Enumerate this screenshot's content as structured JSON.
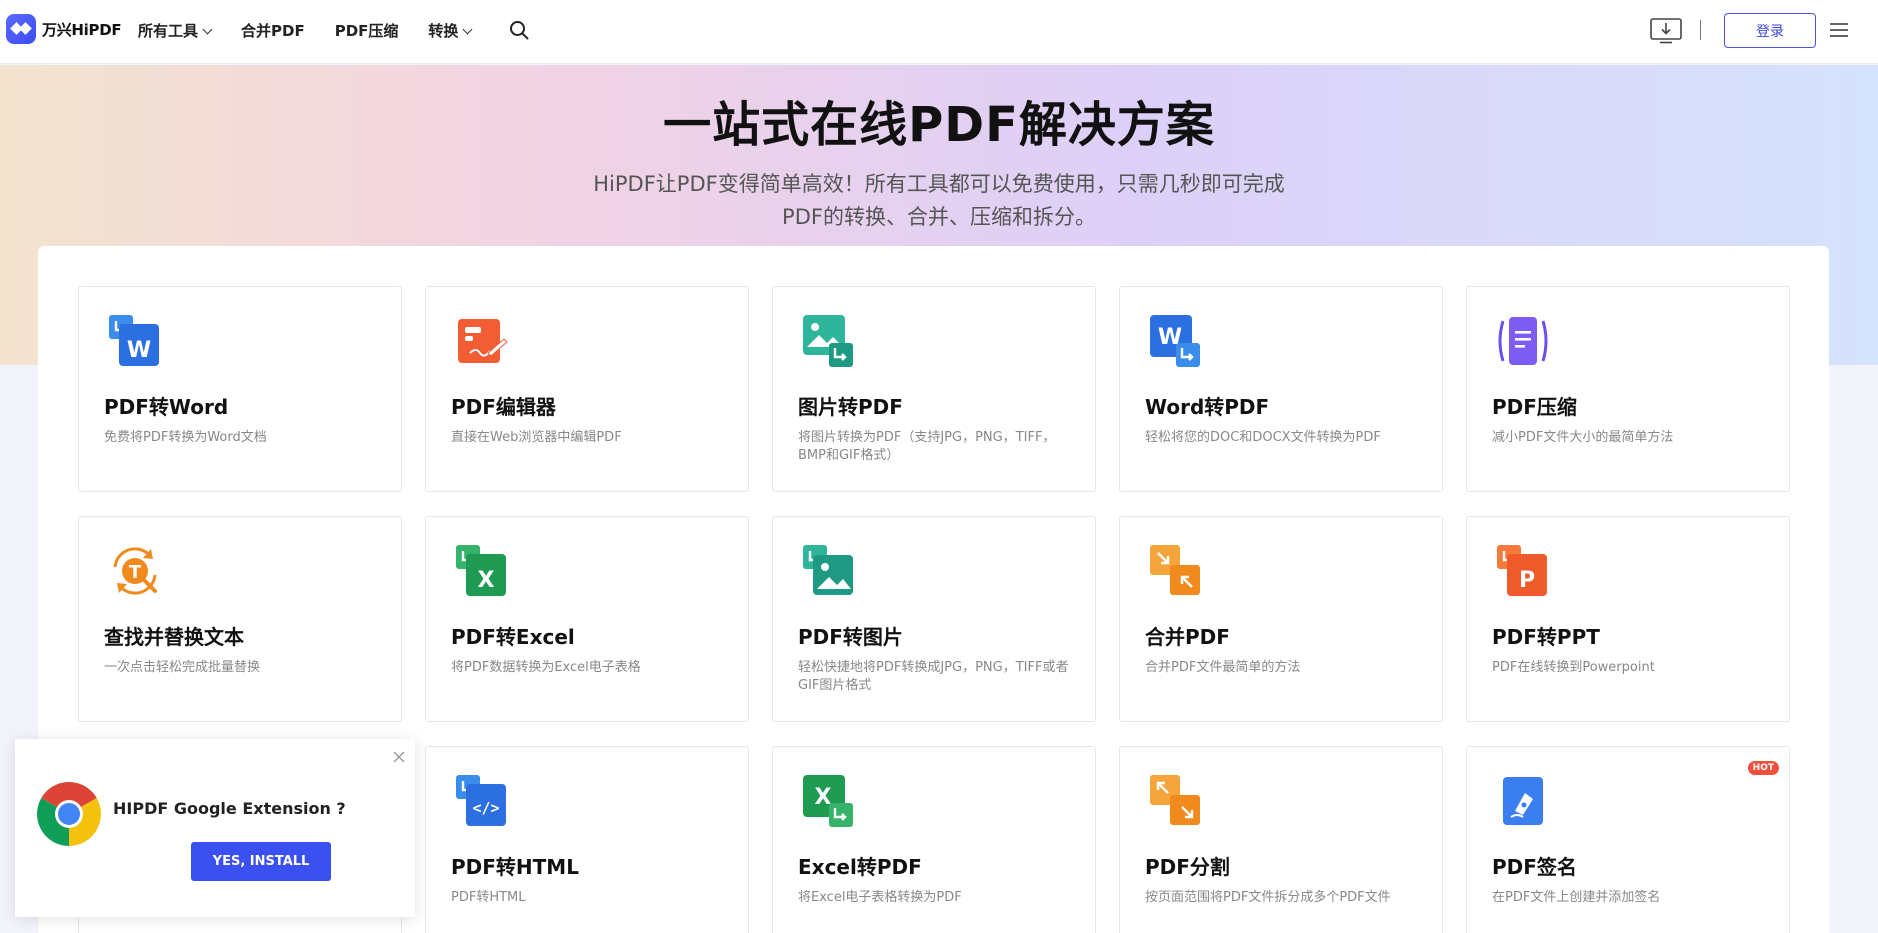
{
  "header": {
    "logo_text": "万兴HiPDF",
    "nav": [
      {
        "label": "所有工具",
        "dropdown": true
      },
      {
        "label": "合并PDF",
        "dropdown": false
      },
      {
        "label": "PDF压缩",
        "dropdown": false
      },
      {
        "label": "转换",
        "dropdown": true
      }
    ],
    "login_label": "登录"
  },
  "hero": {
    "title": "一站式在线PDF解决方案",
    "subtitle_line1": "HiPDF让PDF变得简单高效！所有工具都可以免费使用，只需几秒即可完成",
    "subtitle_line2": "PDF的转换、合并、压缩和拆分。"
  },
  "tools": [
    {
      "title": "PDF转Word",
      "desc": "免费将PDF转换为Word文档",
      "icon": "pdf-to-word-icon"
    },
    {
      "title": "PDF编辑器",
      "desc": "直接在Web浏览器中编辑PDF",
      "icon": "pdf-editor-icon"
    },
    {
      "title": "图片转PDF",
      "desc": "将图片转换为PDF（支持JPG，PNG，TIFF，BMP和GIF格式）",
      "icon": "image-to-pdf-icon"
    },
    {
      "title": "Word转PDF",
      "desc": "轻松将您的DOC和DOCX文件转换为PDF",
      "icon": "word-to-pdf-icon"
    },
    {
      "title": "PDF压缩",
      "desc": "减小PDF文件大小的最简单方法",
      "icon": "pdf-compress-icon"
    },
    {
      "title": "查找并替换文本",
      "desc": "一次点击轻松完成批量替换",
      "icon": "find-replace-icon"
    },
    {
      "title": "PDF转Excel",
      "desc": "将PDF数据转换为Excel电子表格",
      "icon": "pdf-to-excel-icon"
    },
    {
      "title": "PDF转图片",
      "desc": "轻松快捷地将PDF转换成JPG，PNG，TIFF或者GIF图片格式",
      "icon": "pdf-to-image-icon"
    },
    {
      "title": "合并PDF",
      "desc": "合并PDF文件最简单的方法",
      "icon": "merge-pdf-icon"
    },
    {
      "title": "PDF转PPT",
      "desc": "PDF在线转换到Powerpoint",
      "icon": "pdf-to-ppt-icon"
    },
    {
      "title": "",
      "desc": "",
      "icon": ""
    },
    {
      "title": "PDF转HTML",
      "desc": "PDF转HTML",
      "icon": "pdf-to-html-icon"
    },
    {
      "title": "Excel转PDF",
      "desc": "将Excel电子表格转换为PDF",
      "icon": "excel-to-pdf-icon"
    },
    {
      "title": "PDF分割",
      "desc": "按页面范围将PDF文件拆分成多个PDF文件",
      "icon": "pdf-split-icon"
    },
    {
      "title": "PDF签名",
      "desc": "在PDF文件上创建并添加签名",
      "icon": "pdf-sign-icon",
      "badge": "HOT"
    }
  ],
  "popup": {
    "text": "HIPDF Google Extension ?",
    "button": "YES, INSTALL"
  }
}
